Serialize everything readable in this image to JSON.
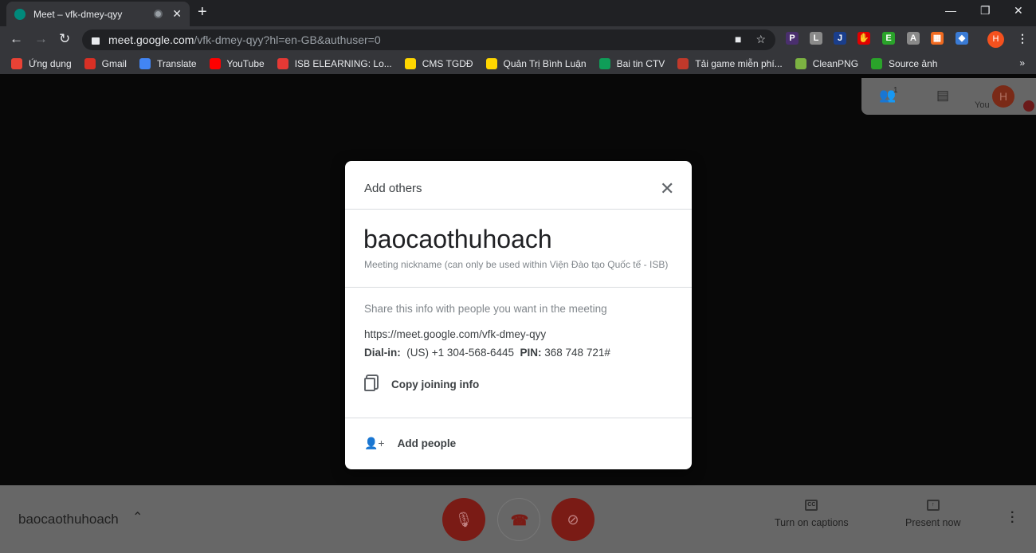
{
  "browser": {
    "tab_title": "Meet – vfk-dmey-qyy",
    "url_host": "meet.google.com",
    "url_path": "/vfk-dmey-qyy?hl=en-GB&authuser=0",
    "profile_initial": "H",
    "extensions": [
      {
        "label": "P",
        "color": "#4a2f6e"
      },
      {
        "label": "L",
        "color": "#8a8a8a"
      },
      {
        "label": "J",
        "color": "#1a3e8c"
      },
      {
        "label": "✋",
        "color": "#e00000"
      },
      {
        "label": "E",
        "color": "#2aa32a"
      },
      {
        "label": "A",
        "color": "#8a8a8a"
      },
      {
        "label": "▦",
        "color": "#f06a20"
      },
      {
        "label": "◆",
        "color": "#3a7bd5"
      }
    ],
    "bookmarks": [
      {
        "label": "Ứng dụng",
        "color": "#e94235"
      },
      {
        "label": "Gmail",
        "color": "#d93025"
      },
      {
        "label": "Translate",
        "color": "#4285f4"
      },
      {
        "label": "YouTube",
        "color": "#ff0000"
      },
      {
        "label": "ISB ELEARNING: Lo...",
        "color": "#e53935"
      },
      {
        "label": "CMS TGDĐ",
        "color": "#ffd600"
      },
      {
        "label": "Quản Trị Bình Luận",
        "color": "#ffd600"
      },
      {
        "label": "Bai tin CTV",
        "color": "#0f9d58"
      },
      {
        "label": "Tải game miễn phí...",
        "color": "#c0392b"
      },
      {
        "label": "CleanPNG",
        "color": "#7cb342"
      },
      {
        "label": "Source ảnh",
        "color": "#2aa32a"
      }
    ],
    "bookmarks_more": "»"
  },
  "meet": {
    "participants_count": "1",
    "you_label": "You",
    "avatar_initial": "H",
    "meeting_name": "baocaothuhoach",
    "captions_label": "Turn on captions",
    "present_label": "Present now",
    "accent": "#8b1a1a"
  },
  "dialog": {
    "title": "Add others",
    "nickname": "baocaothuhoach",
    "nickname_note": "Meeting nickname (can only be used within Viện Đào tạo Quốc tế - ISB)",
    "share_text": "Share this info with people you want in the meeting",
    "link": "https://meet.google.com/vfk-dmey-qyy",
    "dialin_label": "Dial-in:",
    "dialin_number": "(US) +1 304-568-6445",
    "pin_label": "PIN:",
    "pin": "368 748 721#",
    "copy_label": "Copy joining info",
    "add_people_label": "Add people"
  }
}
